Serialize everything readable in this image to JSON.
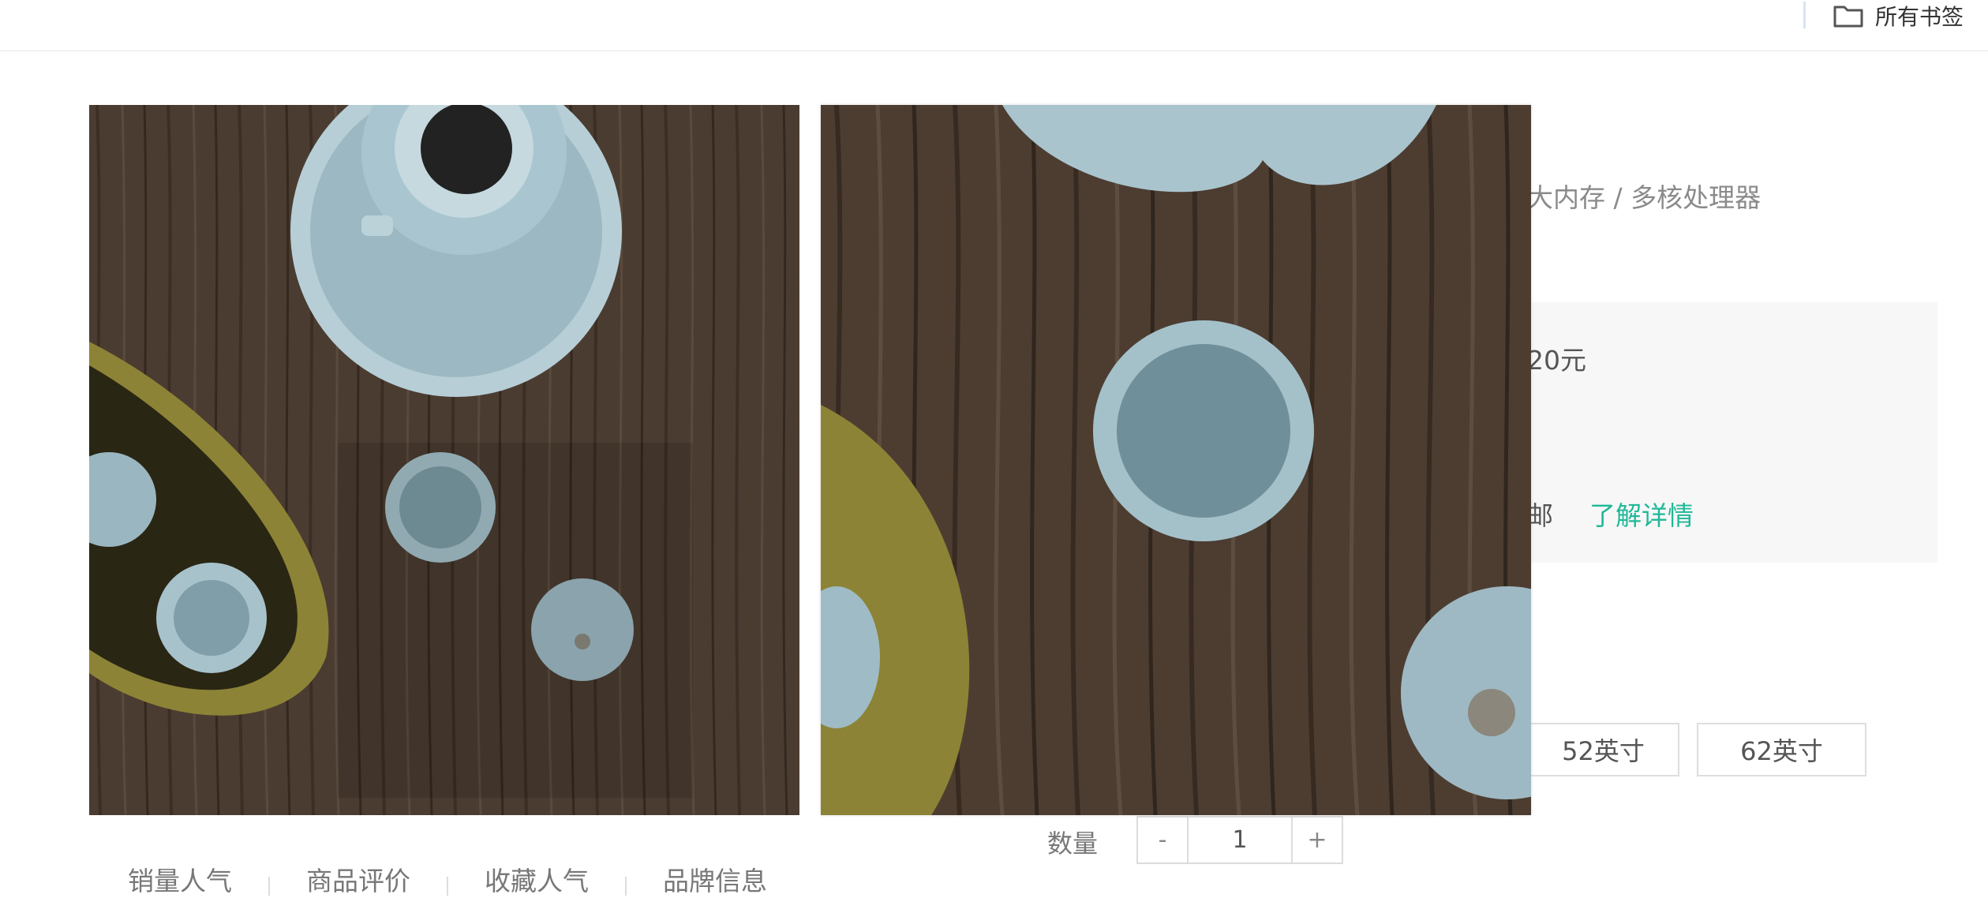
{
  "topbar": {
    "bookmarks_label": "所有书签",
    "bookmarks_icon": "folder-icon"
  },
  "product": {
    "subtitle": "大内存 / 多核处理器",
    "price_fragment": "20元",
    "shipping_fragment": "邮",
    "detail_link": "了解详情",
    "sizes": [
      "52英寸",
      "62英寸"
    ],
    "quantity": {
      "label": "数量",
      "minus": "-",
      "value": "1",
      "plus": "+"
    }
  },
  "tabs": [
    "销量人气",
    "商品评价",
    "收藏人气",
    "品牌信息"
  ],
  "colors": {
    "accent": "#20b898",
    "wood": "#4a3b30",
    "celadon": "#9fbcc6",
    "brass": "#8f8536"
  }
}
